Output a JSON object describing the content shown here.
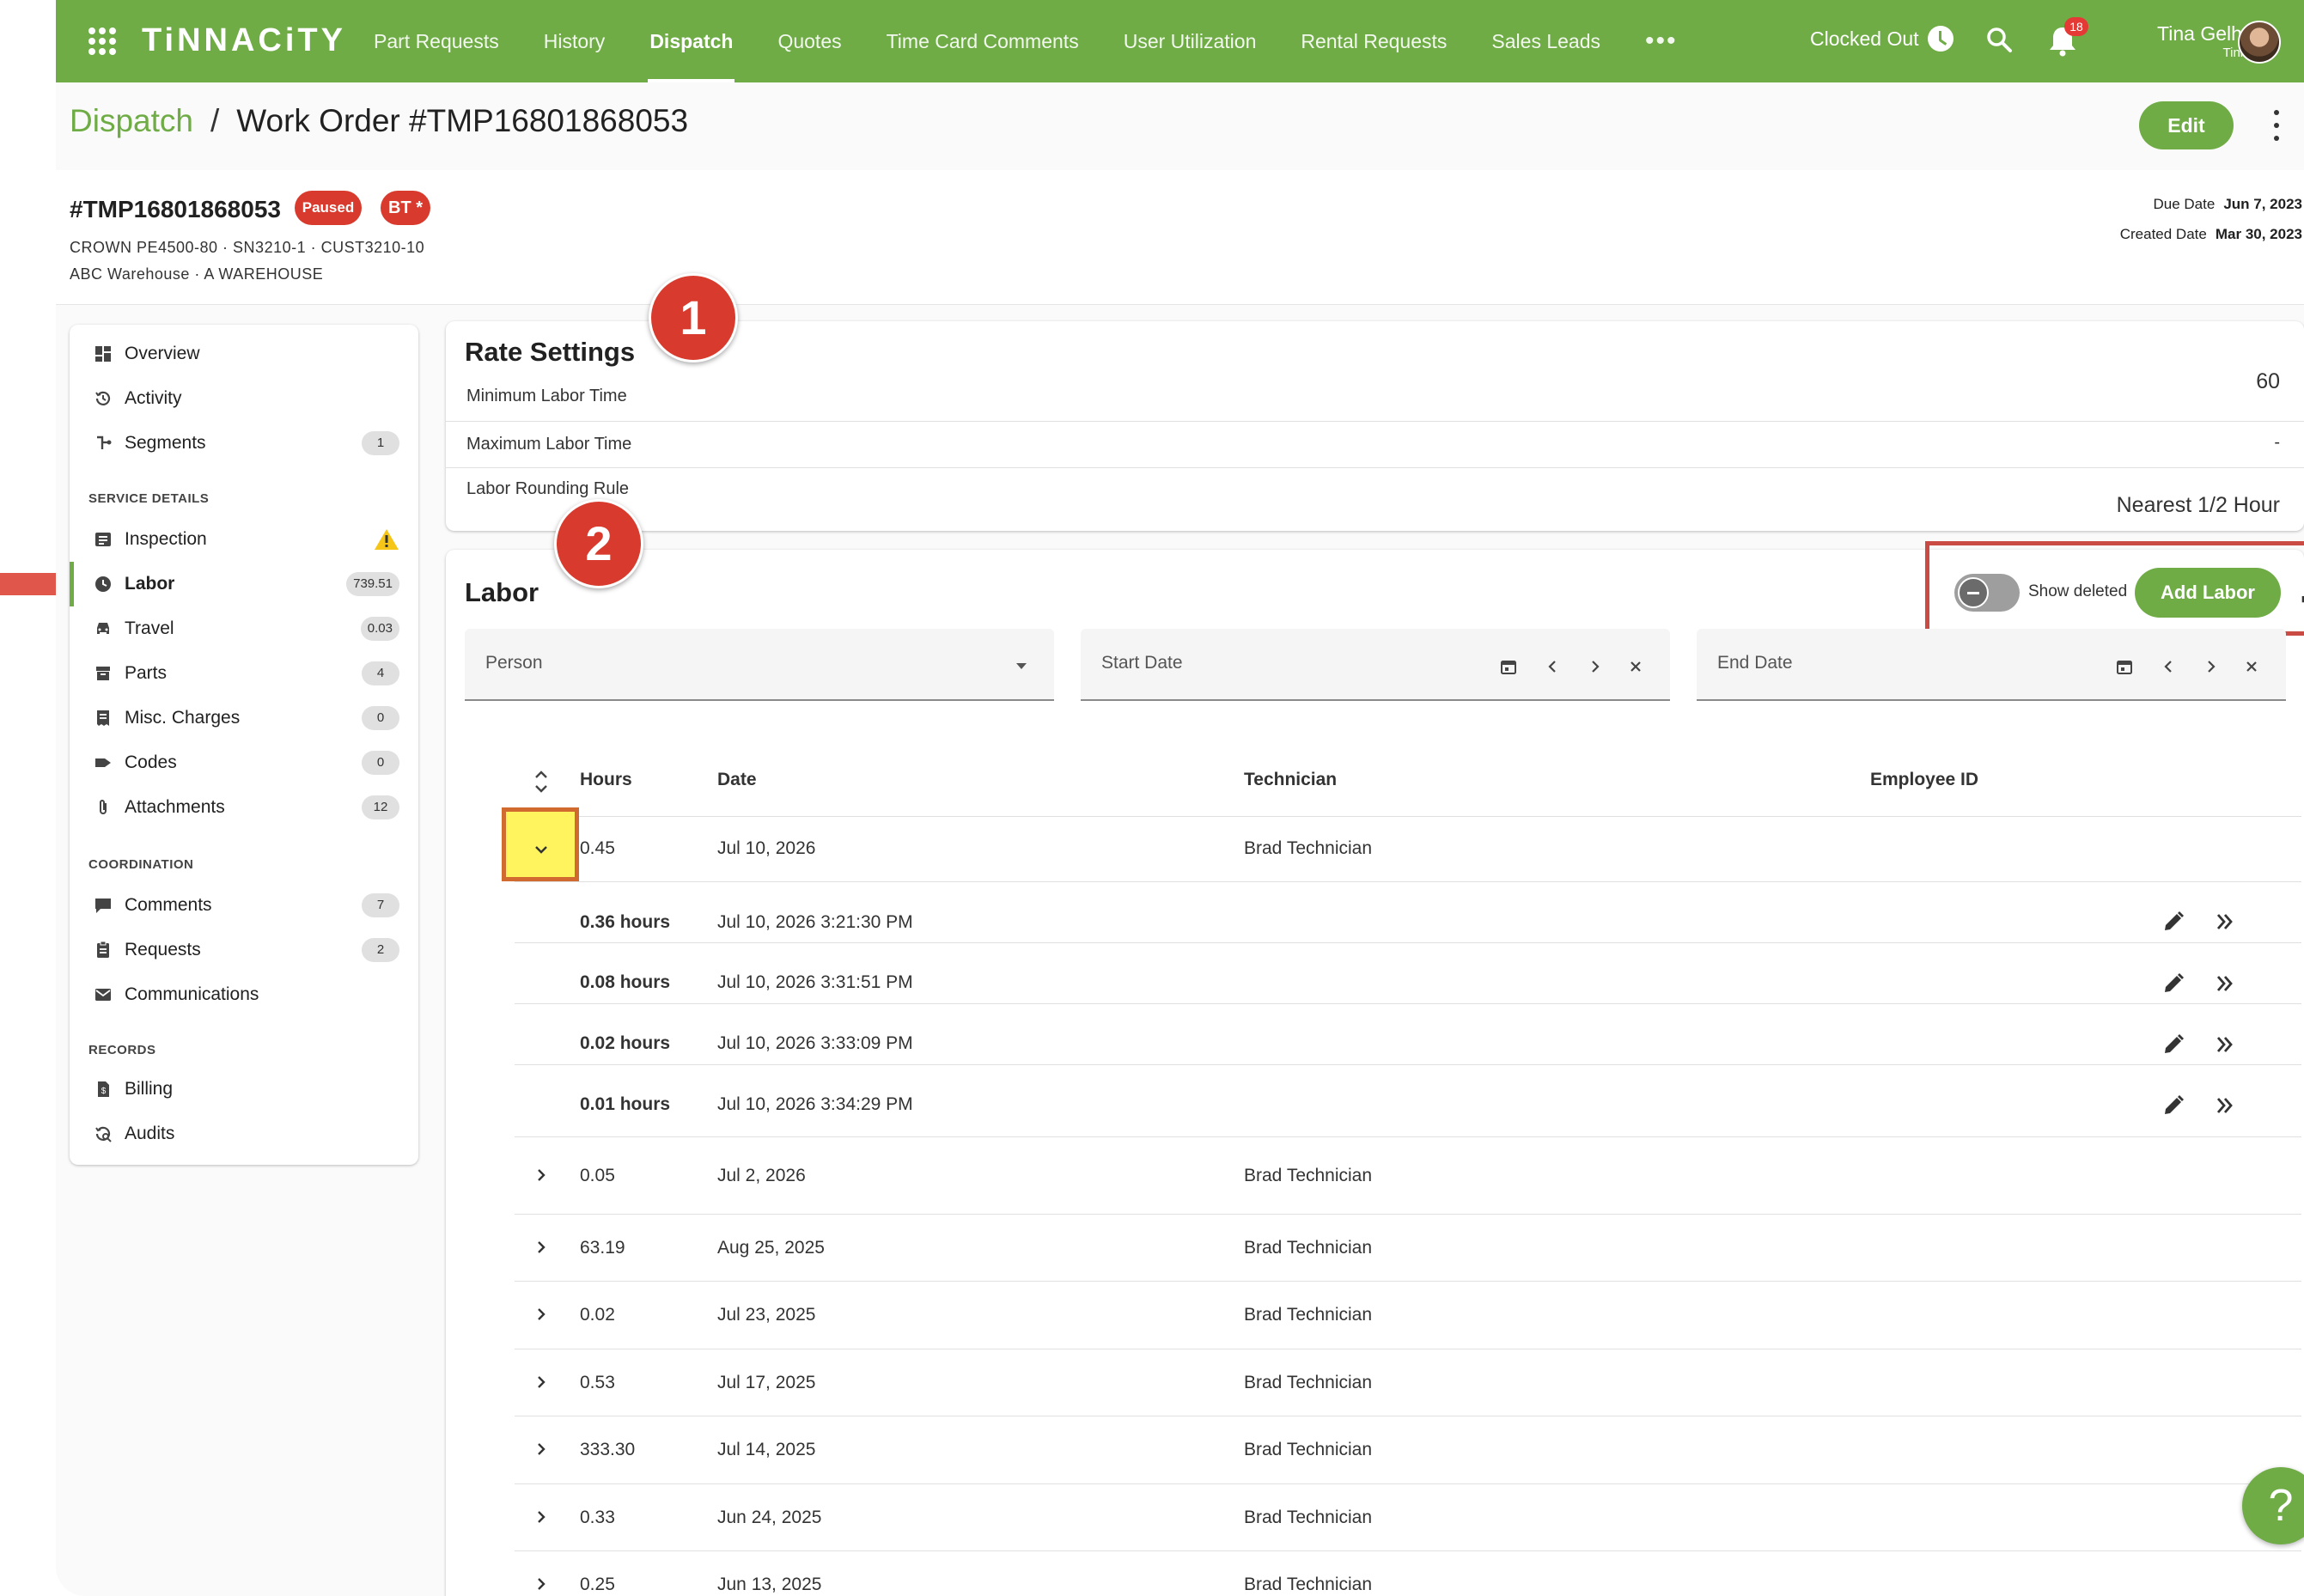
{
  "topbar": {
    "logo": "TiNNACiTY",
    "nav": [
      "Part Requests",
      "History",
      "Dispatch",
      "Quotes",
      "Time Card Comments",
      "User Utilization",
      "Rental Requests",
      "Sales Leads"
    ],
    "active_nav": "Dispatch",
    "more": "•••",
    "clock_status": "Clocked Out",
    "notification_count": "18",
    "user_name": "Tina Gelhaus",
    "user_org": "Tinnacity"
  },
  "breadcrumb": {
    "parent": "Dispatch",
    "separator": "/",
    "current": "Work Order #TMP16801868053"
  },
  "edit_label": "Edit",
  "work_order": {
    "id": "#TMP16801868053",
    "status_badge": "Paused",
    "tag_badge": "BT *",
    "equipment_line": "CROWN PE4500-80 · SN3210-1 · CUST3210-10",
    "location_line": "ABC Warehouse · A WAREHOUSE",
    "due_date_label": "Due Date",
    "due_date": "Jun 7, 2023",
    "created_date_label": "Created Date",
    "created_date": "Mar 30, 2023"
  },
  "sidebar": {
    "items": [
      {
        "label": "Overview",
        "icon": "dashboard-icon"
      },
      {
        "label": "Activity",
        "icon": "history-icon"
      },
      {
        "label": "Segments",
        "icon": "segments-icon",
        "count": "1"
      }
    ],
    "service_section": "SERVICE DETAILS",
    "service_items": [
      {
        "label": "Inspection",
        "icon": "inspection-icon",
        "warning": true
      },
      {
        "label": "Labor",
        "icon": "clock-icon",
        "count": "739.51",
        "active": true
      },
      {
        "label": "Travel",
        "icon": "car-icon",
        "count": "0.03"
      },
      {
        "label": "Parts",
        "icon": "parts-icon",
        "count": "4"
      },
      {
        "label": "Misc. Charges",
        "icon": "receipt-icon",
        "count": "0"
      },
      {
        "label": "Codes",
        "icon": "tag-icon",
        "count": "0"
      },
      {
        "label": "Attachments",
        "icon": "paperclip-icon",
        "count": "12"
      }
    ],
    "coordination_section": "COORDINATION",
    "coordination_items": [
      {
        "label": "Comments",
        "icon": "comment-icon",
        "count": "7"
      },
      {
        "label": "Requests",
        "icon": "clipboard-icon",
        "count": "2"
      },
      {
        "label": "Communications",
        "icon": "mail-icon"
      }
    ],
    "records_section": "RECORDS",
    "records_items": [
      {
        "label": "Billing",
        "icon": "billing-icon"
      },
      {
        "label": "Audits",
        "icon": "audit-icon"
      }
    ]
  },
  "rate_settings": {
    "title": "Rate Settings",
    "step": "1",
    "rows": [
      {
        "label": "Minimum Labor Time",
        "value": "60"
      },
      {
        "label": "Maximum Labor Time",
        "value": "-"
      },
      {
        "label": "Labor Rounding Rule",
        "value": "Nearest 1/2 Hour"
      }
    ]
  },
  "labor": {
    "title": "Labor",
    "step": "2",
    "show_deleted_label": "Show deleted",
    "show_deleted": false,
    "add_label": "Add Labor",
    "filters": {
      "person": "Person",
      "start_date": "Start Date",
      "end_date": "End Date"
    },
    "columns": {
      "hours": "Hours",
      "date": "Date",
      "technician": "Technician",
      "employee_id": "Employee ID"
    },
    "expanded_row": {
      "hours": "0.45",
      "date": "Jul 10, 2026",
      "technician": "Brad Technician"
    },
    "entries": [
      {
        "hours": "0.36 hours",
        "time": "Jul 10, 2026 3:21:30 PM"
      },
      {
        "hours": "0.08 hours",
        "time": "Jul 10, 2026 3:31:51 PM"
      },
      {
        "hours": "0.02 hours",
        "time": "Jul 10, 2026 3:33:09 PM"
      },
      {
        "hours": "0.01 hours",
        "time": "Jul 10, 2026 3:34:29 PM"
      }
    ],
    "rows": [
      {
        "hours": "0.05",
        "date": "Jul 2, 2026",
        "technician": "Brad Technician"
      },
      {
        "hours": "63.19",
        "date": "Aug 25, 2025",
        "technician": "Brad Technician"
      },
      {
        "hours": "0.02",
        "date": "Jul 23, 2025",
        "technician": "Brad Technician"
      },
      {
        "hours": "0.53",
        "date": "Jul 17, 2025",
        "technician": "Brad Technician"
      },
      {
        "hours": "333.30",
        "date": "Jul 14, 2025",
        "technician": "Brad Technician"
      },
      {
        "hours": "0.33",
        "date": "Jun 24, 2025",
        "technician": "Brad Technician"
      },
      {
        "hours": "0.25",
        "date": "Jun 13, 2025",
        "technician": "Brad Technician"
      }
    ]
  },
  "help_label": "?",
  "colors": {
    "brand": "#6fac46",
    "alert": "#d83b2d",
    "highlight": "#fff35e"
  }
}
